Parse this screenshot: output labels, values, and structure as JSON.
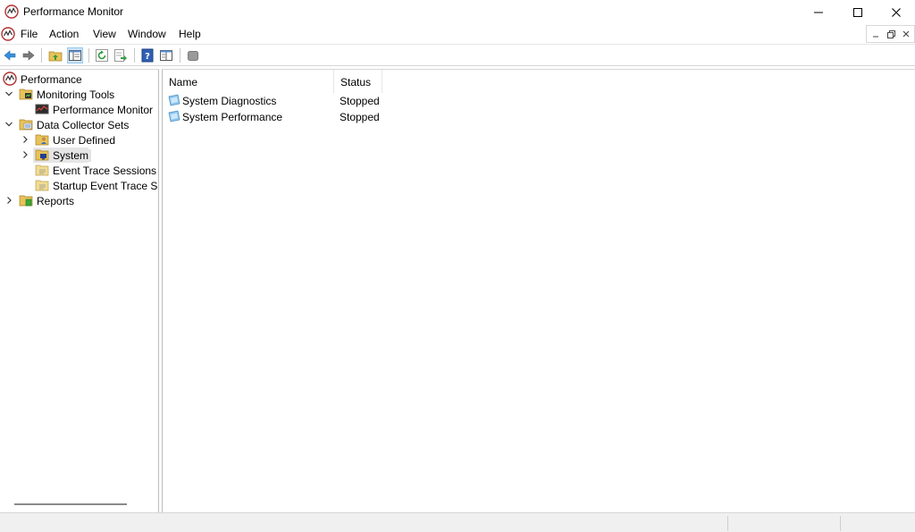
{
  "window": {
    "title": "Performance Monitor",
    "controls": {
      "minimize": "minimize-icon",
      "maximize": "maximize-icon",
      "close": "close-icon"
    }
  },
  "menu": {
    "items": [
      "File",
      "Action",
      "View",
      "Window",
      "Help"
    ]
  },
  "toolbar": {
    "buttons": [
      "back-icon",
      "forward-icon",
      "up-folder-icon",
      "show-hide-tree-icon",
      "refresh-icon",
      "export-list-icon",
      "help-icon",
      "properties-icon",
      "stop-icon"
    ]
  },
  "tree": {
    "items": [
      {
        "label": "Performance",
        "icon": "performance-icon",
        "expanded": null
      },
      {
        "label": "Monitoring Tools",
        "icon": "monitoring-tools-icon",
        "expanded": true
      },
      {
        "label": "Performance Monitor",
        "icon": "performance-monitor-icon",
        "expanded": null
      },
      {
        "label": "Data Collector Sets",
        "icon": "data-collector-sets-icon",
        "expanded": true
      },
      {
        "label": "User Defined",
        "icon": "user-defined-icon",
        "expanded": false
      },
      {
        "label": "System",
        "icon": "system-folder-icon",
        "expanded": false,
        "selected": true
      },
      {
        "label": "Event Trace Sessions",
        "icon": "event-trace-icon",
        "expanded": null
      },
      {
        "label": "Startup Event Trace Sess",
        "icon": "startup-trace-icon",
        "expanded": null
      },
      {
        "label": "Reports",
        "icon": "reports-icon",
        "expanded": false
      }
    ]
  },
  "list": {
    "columns": [
      "Name",
      "Status"
    ],
    "rows": [
      {
        "name": "System Diagnostics",
        "status": "Stopped",
        "icon": "collector-set-icon"
      },
      {
        "name": "System Performance",
        "status": "Stopped",
        "icon": "collector-set-icon"
      }
    ]
  },
  "colors": {
    "accent": "#cce4f7",
    "selection": "#e5e5e5",
    "border": "#bdbdbd"
  }
}
